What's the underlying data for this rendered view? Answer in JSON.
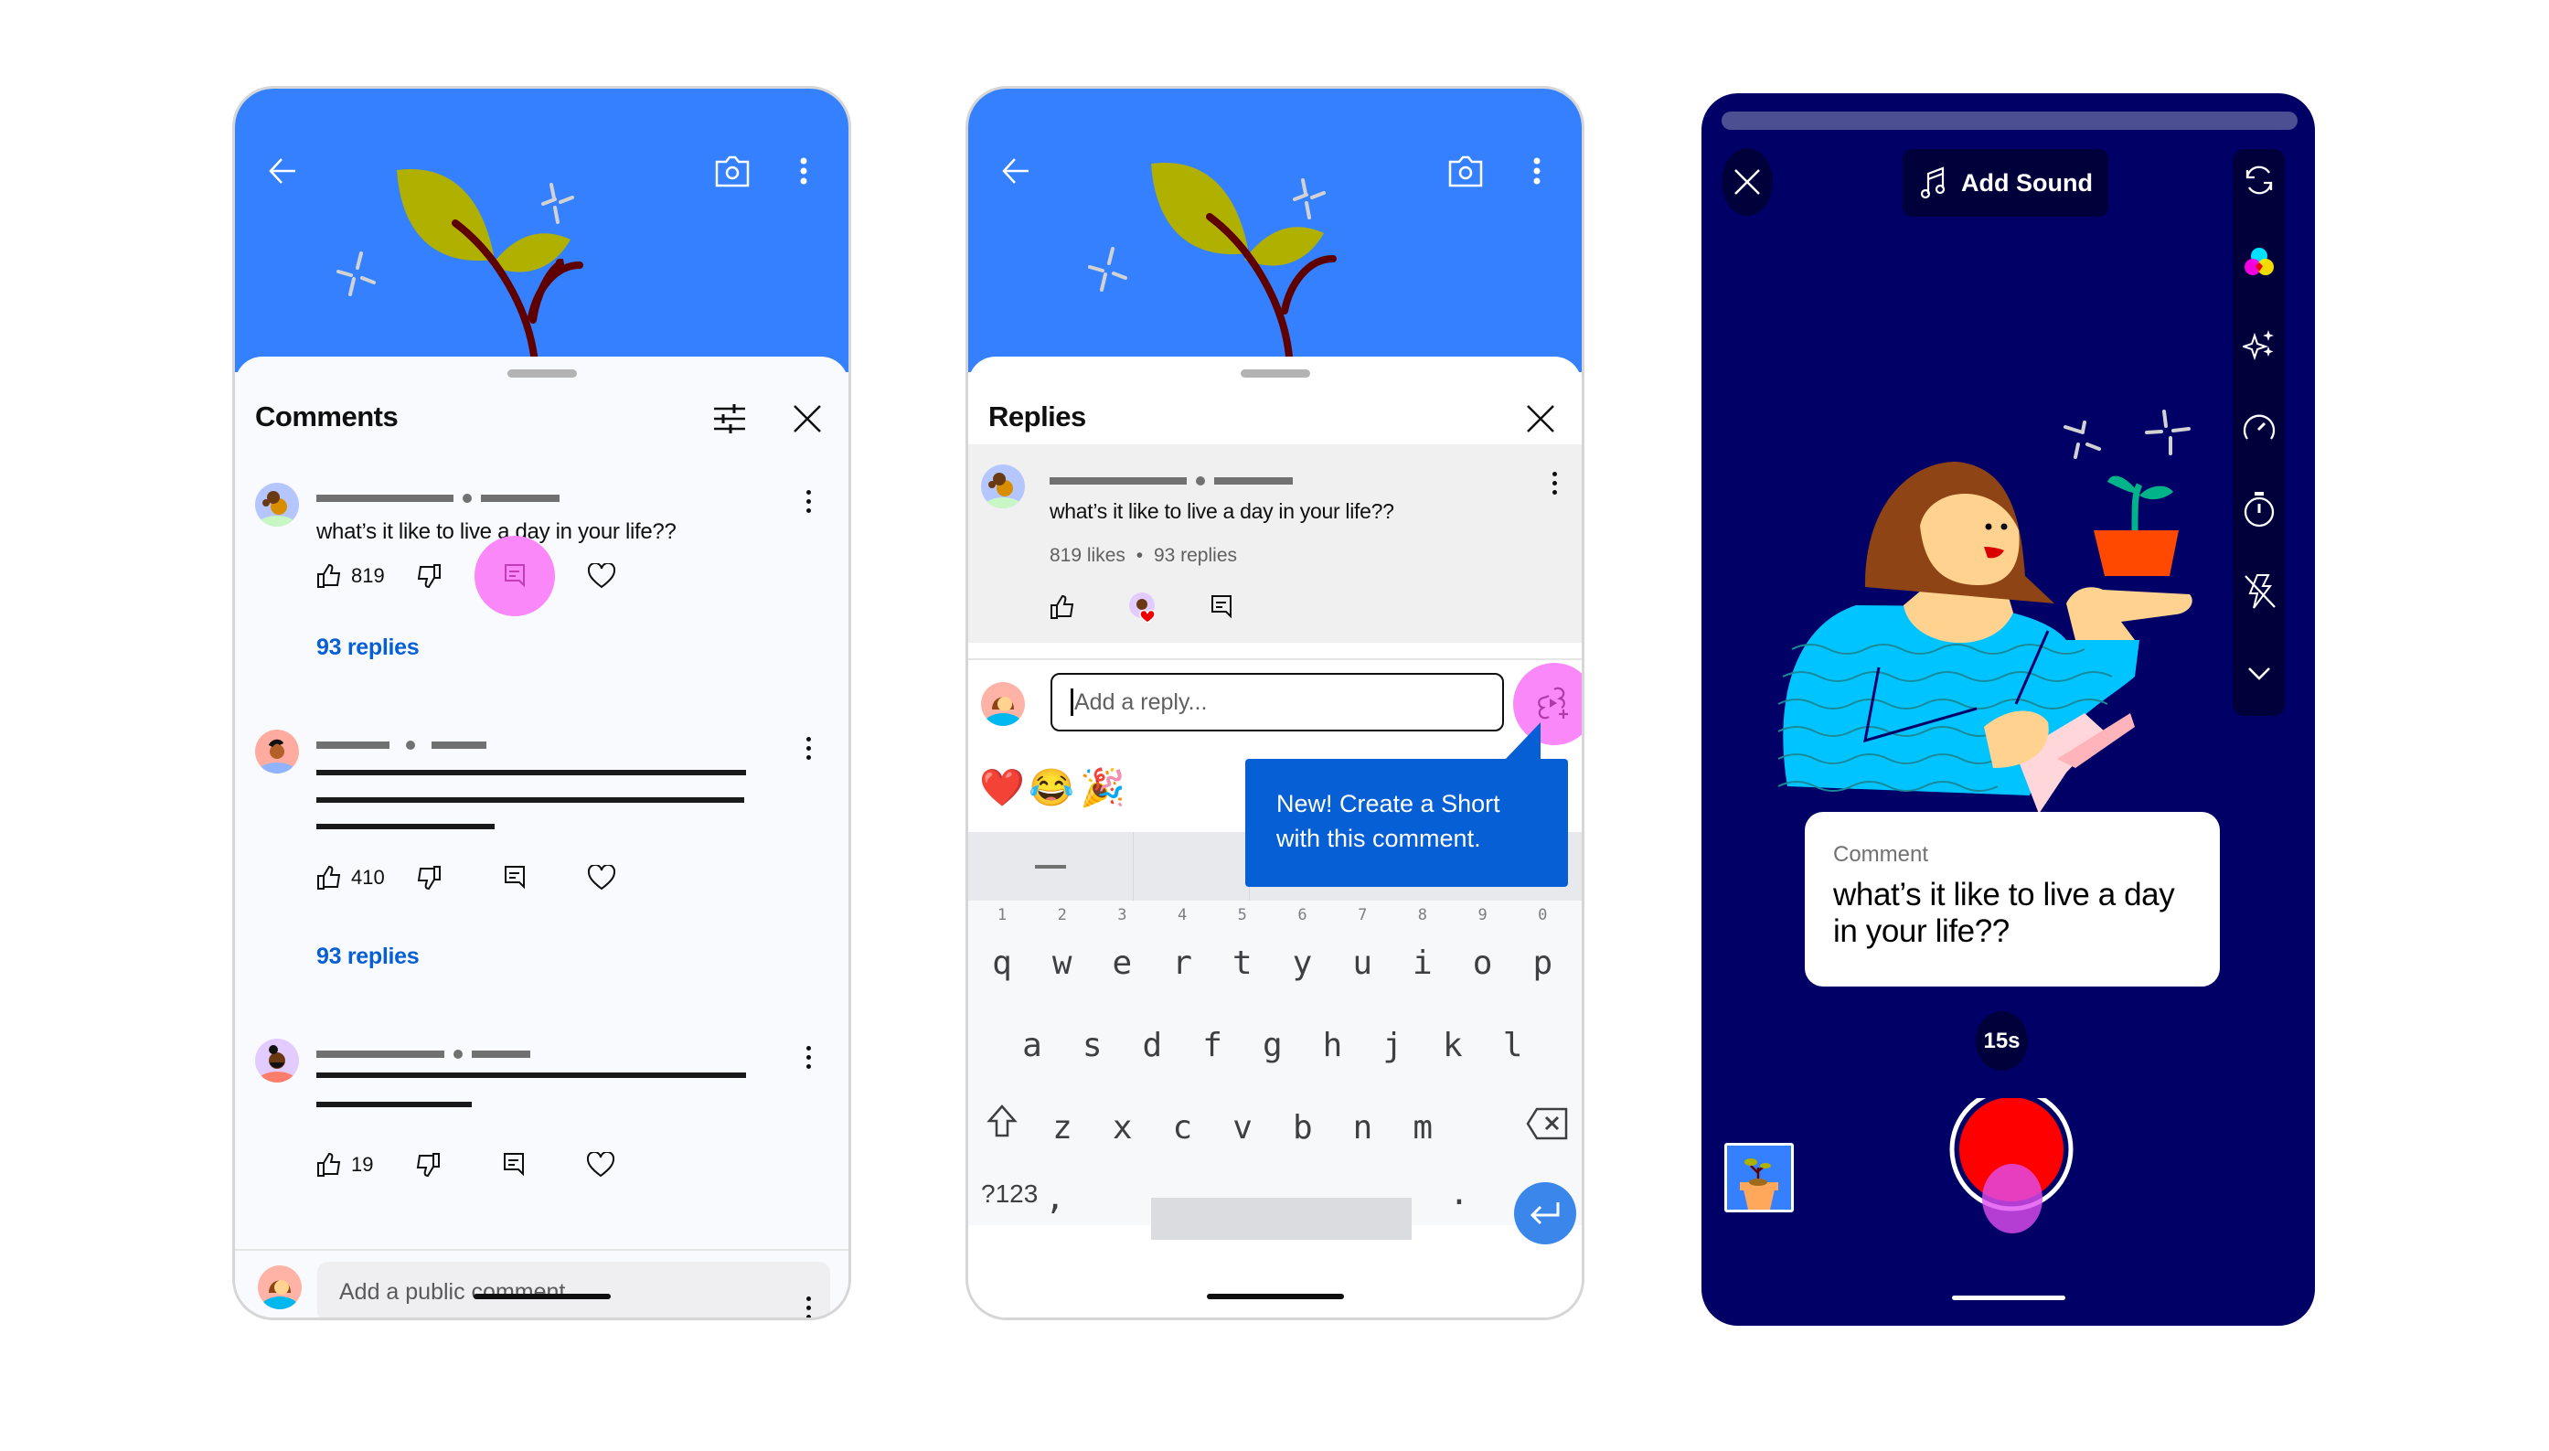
{
  "screens": {
    "comments": {
      "header": {
        "back_icon": "arrow-left-icon",
        "camera_icon": "camera-icon",
        "more_icon": "more-vert-icon"
      },
      "sheet": {
        "title": "Comments",
        "filter_icon": "tune-icon",
        "close_icon": "close-icon"
      },
      "comments": [
        {
          "text": "what’s it like to live a day in your life??",
          "likes": "819",
          "replies_label": "93 replies",
          "reply_highlighted": true
        },
        {
          "text": "",
          "likes": "410",
          "replies_label": "93 replies",
          "reply_highlighted": false
        },
        {
          "text": "",
          "likes": "19",
          "replies_label": "",
          "reply_highlighted": false
        }
      ],
      "composer": {
        "placeholder": "Add a public comment..."
      }
    },
    "replies": {
      "header": {
        "back_icon": "arrow-left-icon",
        "camera_icon": "camera-icon",
        "more_icon": "more-vert-icon"
      },
      "sheet": {
        "title": "Replies",
        "close_icon": "close-icon"
      },
      "parent_comment": {
        "text": "what’s it like to live a day in your life??",
        "likes_label": "819 likes",
        "separator": "•",
        "replies_label": "93 replies"
      },
      "reply_input": {
        "placeholder": "Add a reply..."
      },
      "create_short_icon": "shorts-create-icon",
      "emojis": [
        "❤️",
        "😂",
        "🎉"
      ],
      "tooltip": {
        "line1": "New! Create a Short",
        "line2": "with this comment."
      },
      "keyboard": {
        "number_hints": [
          "1",
          "2",
          "3",
          "4",
          "5",
          "6",
          "7",
          "8",
          "9",
          "0"
        ],
        "row1": [
          "q",
          "w",
          "e",
          "r",
          "t",
          "y",
          "u",
          "i",
          "o",
          "p"
        ],
        "row2": [
          "a",
          "s",
          "d",
          "f",
          "g",
          "h",
          "j",
          "k",
          "l"
        ],
        "row3": [
          "z",
          "x",
          "c",
          "v",
          "b",
          "n",
          "m"
        ],
        "symbols_key": "?123",
        "comma_key": ",",
        "period_key": "."
      }
    },
    "camera": {
      "add_sound_label": "Add Sound",
      "rail_icons": [
        "flip-camera-icon",
        "color-filter-icon",
        "effects-icon",
        "speed-icon",
        "timer-icon",
        "flash-off-icon",
        "chevron-down-icon"
      ],
      "comment_card": {
        "label": "Comment",
        "text": "what’s it like to live a day in your life??"
      },
      "duration_label": "15s"
    }
  },
  "colors": {
    "hero_blue": "#3580ff",
    "link_blue": "#065fd4",
    "highlight_pink": "#fa88f9",
    "camera_navy": "#000066",
    "record_red": "#ff0000"
  }
}
